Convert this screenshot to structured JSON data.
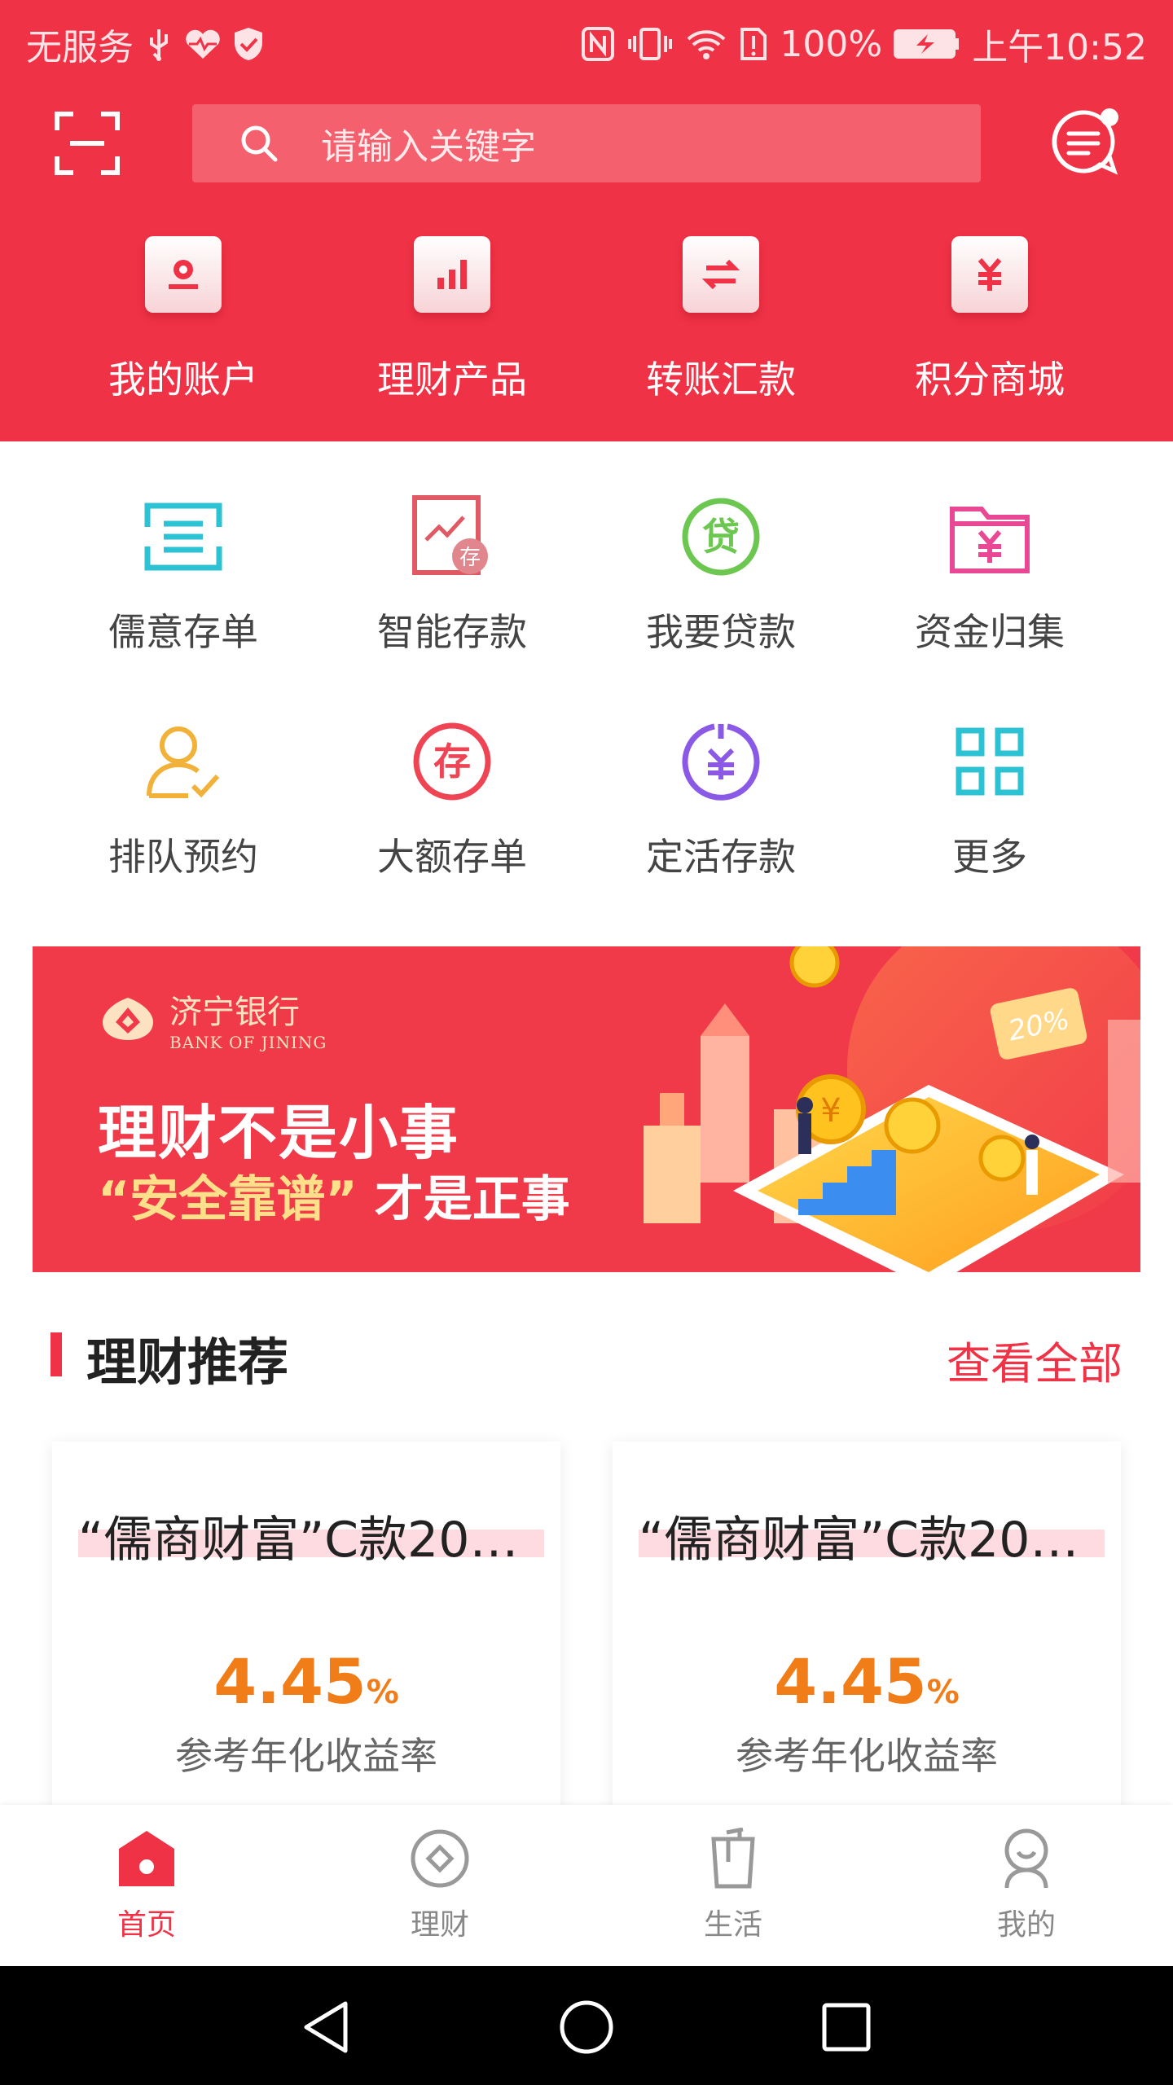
{
  "status_bar": {
    "carrier": "无服务",
    "battery": "100%",
    "time": "上午10:52"
  },
  "search": {
    "placeholder": "请输入关键字"
  },
  "top_nav": [
    {
      "label": "我的账户",
      "icon": "account-icon"
    },
    {
      "label": "理财产品",
      "icon": "bar-chart-icon"
    },
    {
      "label": "转账汇款",
      "icon": "transfer-icon"
    },
    {
      "label": "积分商城",
      "icon": "yuan-icon"
    }
  ],
  "services": [
    {
      "label": "儒意存单",
      "icon": "list-icon",
      "color": "#2cc2d4"
    },
    {
      "label": "智能存款",
      "icon": "trend-deposit-icon",
      "color": "#e05a63"
    },
    {
      "label": "我要贷款",
      "icon": "loan-icon",
      "color": "#6cc750"
    },
    {
      "label": "资金归集",
      "icon": "folder-yuan-icon",
      "color": "#e94895"
    },
    {
      "label": "排队预约",
      "icon": "person-check-icon",
      "color": "#f2b23a"
    },
    {
      "label": "大额存单",
      "icon": "deposit-circle-icon",
      "color": "#ee4453"
    },
    {
      "label": "定活存款",
      "icon": "yuan-circle-icon",
      "color": "#8a5ae6"
    },
    {
      "label": "更多",
      "icon": "grid-icon",
      "color": "#2cc2d4"
    }
  ],
  "banner": {
    "logo_cn": "济宁银行",
    "logo_en": "BANK OF JINING",
    "headline": "理财不是小事",
    "sub_highlight": "“安全靠谱”",
    "sub_rest": "才是正事",
    "badge": "20%"
  },
  "section": {
    "title": "理财推荐",
    "more": "查看全部"
  },
  "products": [
    {
      "title": "“儒商财富”C款201…",
      "rate": "4.45",
      "unit": "%",
      "desc": "参考年化收益率"
    },
    {
      "title": "“儒商财富”C款201…",
      "rate": "4.45",
      "unit": "%",
      "desc": "参考年化收益率"
    }
  ],
  "tabs": [
    {
      "label": "首页",
      "icon": "home-icon",
      "active": true
    },
    {
      "label": "理财",
      "icon": "coin-icon",
      "active": false
    },
    {
      "label": "生活",
      "icon": "cup-icon",
      "active": false
    },
    {
      "label": "我的",
      "icon": "user-icon",
      "active": false
    }
  ],
  "colors": {
    "brand_red": "#f03246",
    "rate_orange": "#f07d18"
  }
}
